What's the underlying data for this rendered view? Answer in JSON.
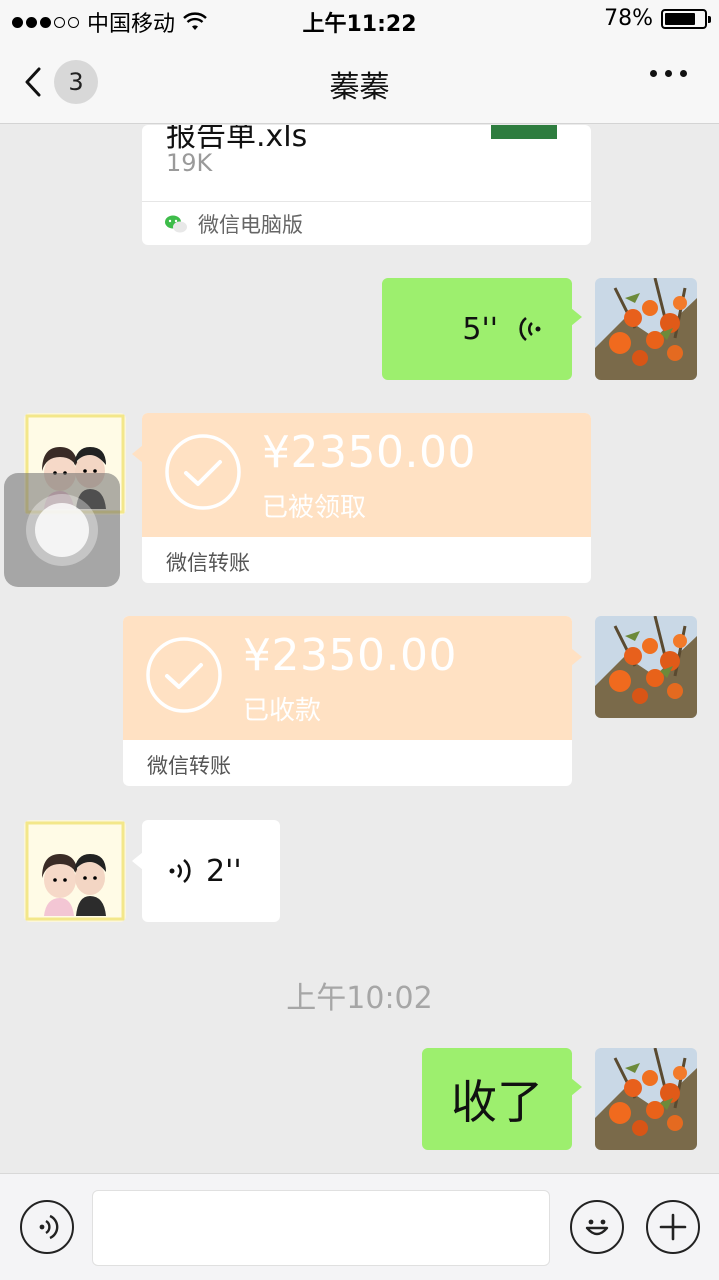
{
  "status_bar": {
    "carrier": "中国移动",
    "time": "上午11:22",
    "battery_pct": "78%",
    "battery_level": 0.78
  },
  "nav": {
    "unread_count": "3",
    "title": "蓁蓁"
  },
  "messages": {
    "file": {
      "name": "报告单.xls",
      "size": "19K",
      "source": "微信电脑版"
    },
    "voice_out": {
      "duration": "5''"
    },
    "transfer_in": {
      "amount": "¥2350.00",
      "status": "已被领取",
      "label": "微信转账"
    },
    "transfer_out": {
      "amount": "¥2350.00",
      "status": "已收款",
      "label": "微信转账"
    },
    "voice_in": {
      "duration": "2''"
    },
    "timestamp": "上午10:02",
    "text_out": "收了"
  },
  "input_bar": {
    "placeholder": ""
  },
  "colors": {
    "sent_bubble": "#9def6e",
    "transfer_bg": "#ffe1c3",
    "chat_bg": "#ebebeb"
  }
}
